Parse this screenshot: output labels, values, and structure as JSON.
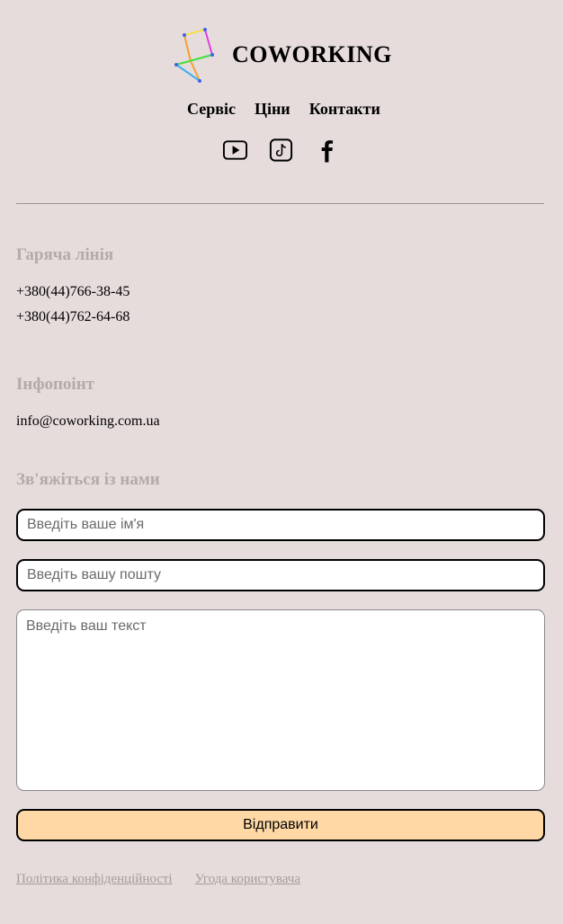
{
  "header": {
    "brand_name": "COWORKING",
    "nav": [
      "Сервіс",
      "Ціни",
      "Контакти"
    ],
    "social": [
      {
        "icon": "youtube-icon"
      },
      {
        "icon": "tiktok-icon"
      },
      {
        "icon": "facebook-icon"
      }
    ]
  },
  "hotline": {
    "title": "Гаряча лінія",
    "phones": [
      "+380(44)766-38-45",
      "+380(44)762-64-68"
    ]
  },
  "infopoint": {
    "title": "Інфопоінт",
    "email": "info@coworking.com.ua"
  },
  "contact_form": {
    "title": "Зв'яжіться із нами",
    "name_placeholder": "Введіть ваше ім'я",
    "email_placeholder": "Введіть вашу пошту",
    "message_placeholder": "Введіть ваш текст",
    "submit_label": "Відправити"
  },
  "footer": {
    "links": [
      "Політика конфіденційності",
      "Угода користувача"
    ]
  },
  "colors": {
    "background": "#e6dcdc",
    "section_title": "#b3aaaa",
    "submit_button": "#ffd8a6",
    "footer_link": "#a59c9c"
  }
}
